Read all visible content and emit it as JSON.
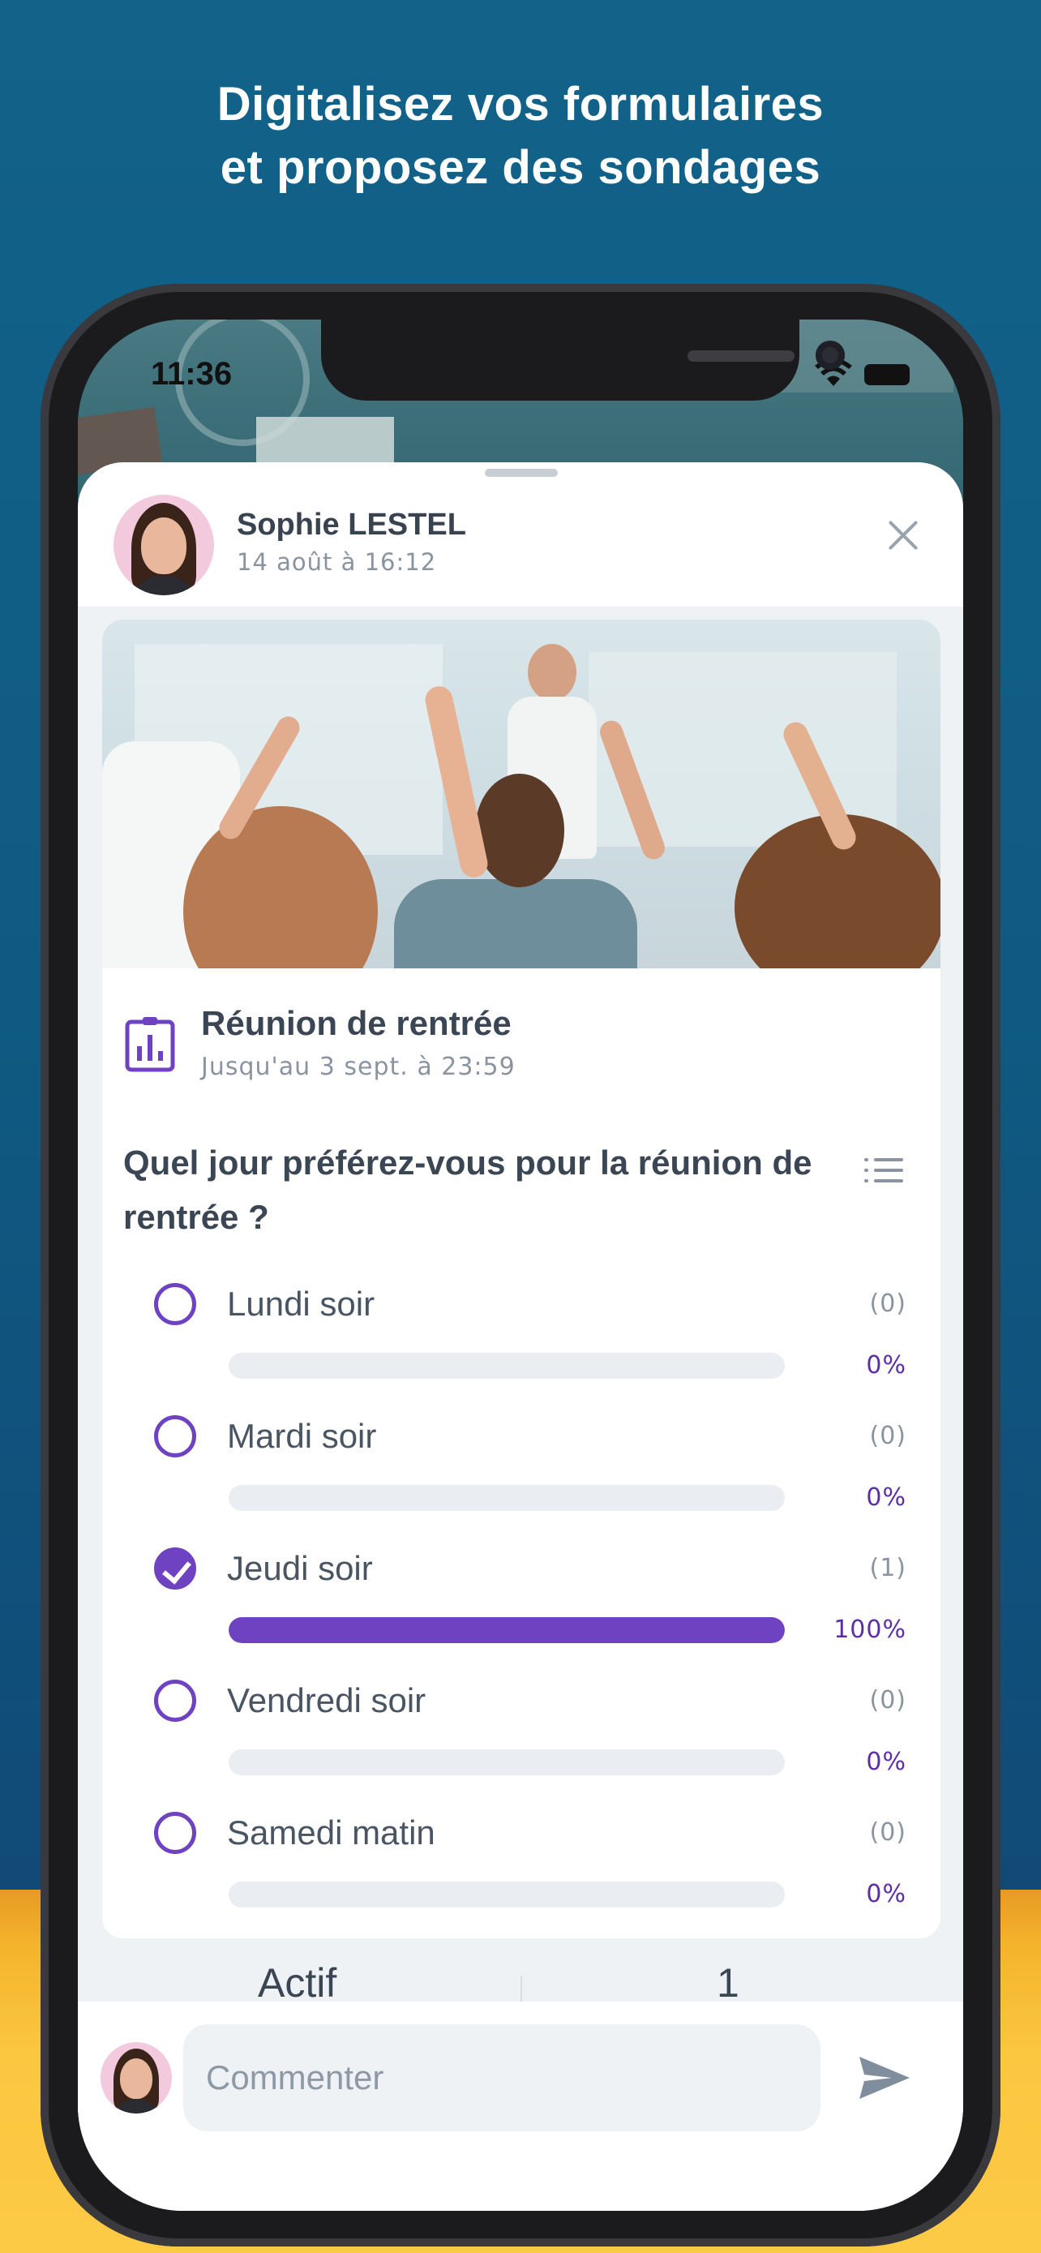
{
  "headline": {
    "line1": "Digitalisez vos formulaires",
    "line2": "et proposez des sondages"
  },
  "status_bar": {
    "time": "11:36"
  },
  "post": {
    "author": "Sophie LESTEL",
    "date": "14 août à 16:12"
  },
  "poll": {
    "title": "Réunion de rentrée",
    "deadline": "Jusqu'au 3 sept. à 23:59",
    "question": "Quel jour préférez-vous pour la réunion de rentrée ?",
    "options": [
      {
        "label": "Lundi soir",
        "count": "(0)",
        "percent": "0%",
        "fraction": 0,
        "selected": false
      },
      {
        "label": "Mardi soir",
        "count": "(0)",
        "percent": "0%",
        "fraction": 0,
        "selected": false
      },
      {
        "label": "Jeudi soir",
        "count": "(1)",
        "percent": "100%",
        "fraction": 1,
        "selected": true
      },
      {
        "label": "Vendredi soir",
        "count": "(0)",
        "percent": "0%",
        "fraction": 0,
        "selected": false
      },
      {
        "label": "Samedi matin",
        "count": "(0)",
        "percent": "0%",
        "fraction": 0,
        "selected": false
      }
    ]
  },
  "stats": {
    "label": "Actif",
    "value": "1"
  },
  "comment": {
    "placeholder": "Commenter"
  },
  "colors": {
    "accent": "#6e42c1",
    "background": "#12628a",
    "band": "#fdca46"
  },
  "icons": {
    "close": "close-icon",
    "list": "list-icon",
    "poll": "bar-chart-icon",
    "send": "send-icon"
  }
}
